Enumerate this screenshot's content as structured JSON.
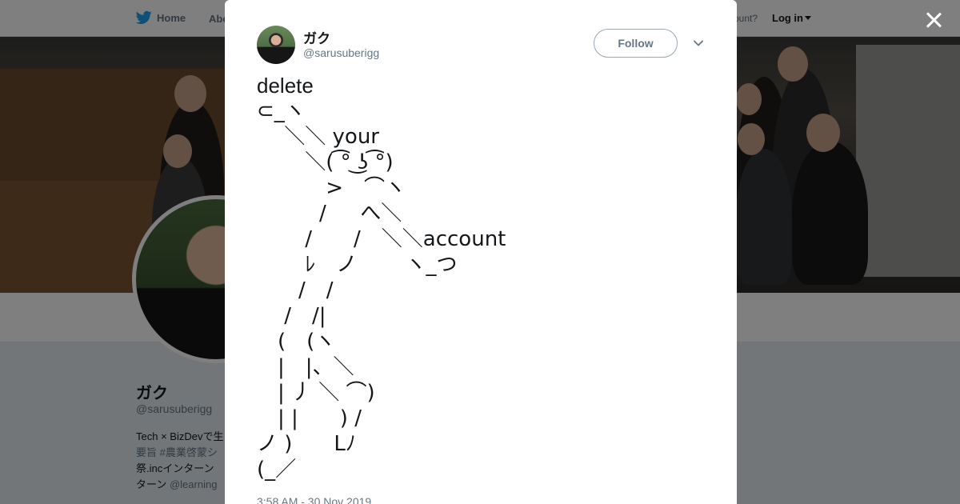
{
  "nav": {
    "home": "Home",
    "about": "Abo",
    "account_question": "ccount?",
    "login": "Log in"
  },
  "profile": {
    "name": "ガク",
    "handle": "@sarusuberigg",
    "bio_lines": [
      {
        "text": "Tech × BizDevで生",
        "muted": ""
      },
      {
        "text": "",
        "muted": "要旨 #農業啓蒙シ"
      },
      {
        "text": "祭.incインターン",
        "muted": ""
      },
      {
        "text": "ターン ",
        "muted": "@learning"
      }
    ]
  },
  "tweet": {
    "author_name": "ガク",
    "author_handle": "@sarusuberigg",
    "follow_label": "Follow",
    "lines": [
      "delete",
      "⊂_ヽ",
      "　 ＼＼ your",
      "　　 ＼( ͡° ͜ʖ ͡°)",
      "　　　 >　⌒ヽ",
      "　　　/ 　 へ＼",
      "　　 /　　/　＼＼account",
      "　　 ﾚ　ノ　　 ヽ_つ",
      "　　/　/",
      "　 /　/|",
      "　(　(ヽ",
      "　|　|、＼",
      "　| 丿 ＼ ⌒)",
      "　| |　　) /",
      "ノ )　　Lﾉ",
      "(_／"
    ],
    "timestamp": "3:58 AM - 30 Nov 2019"
  },
  "colors": {
    "brand": "#1da1f2",
    "text_primary": "#14171a",
    "text_secondary": "#657786",
    "overlay": "rgba(0,0,0,0.5)"
  },
  "icons": {
    "home": "twitter-bird-icon",
    "close": "close-icon",
    "more": "chevron-down-icon"
  }
}
